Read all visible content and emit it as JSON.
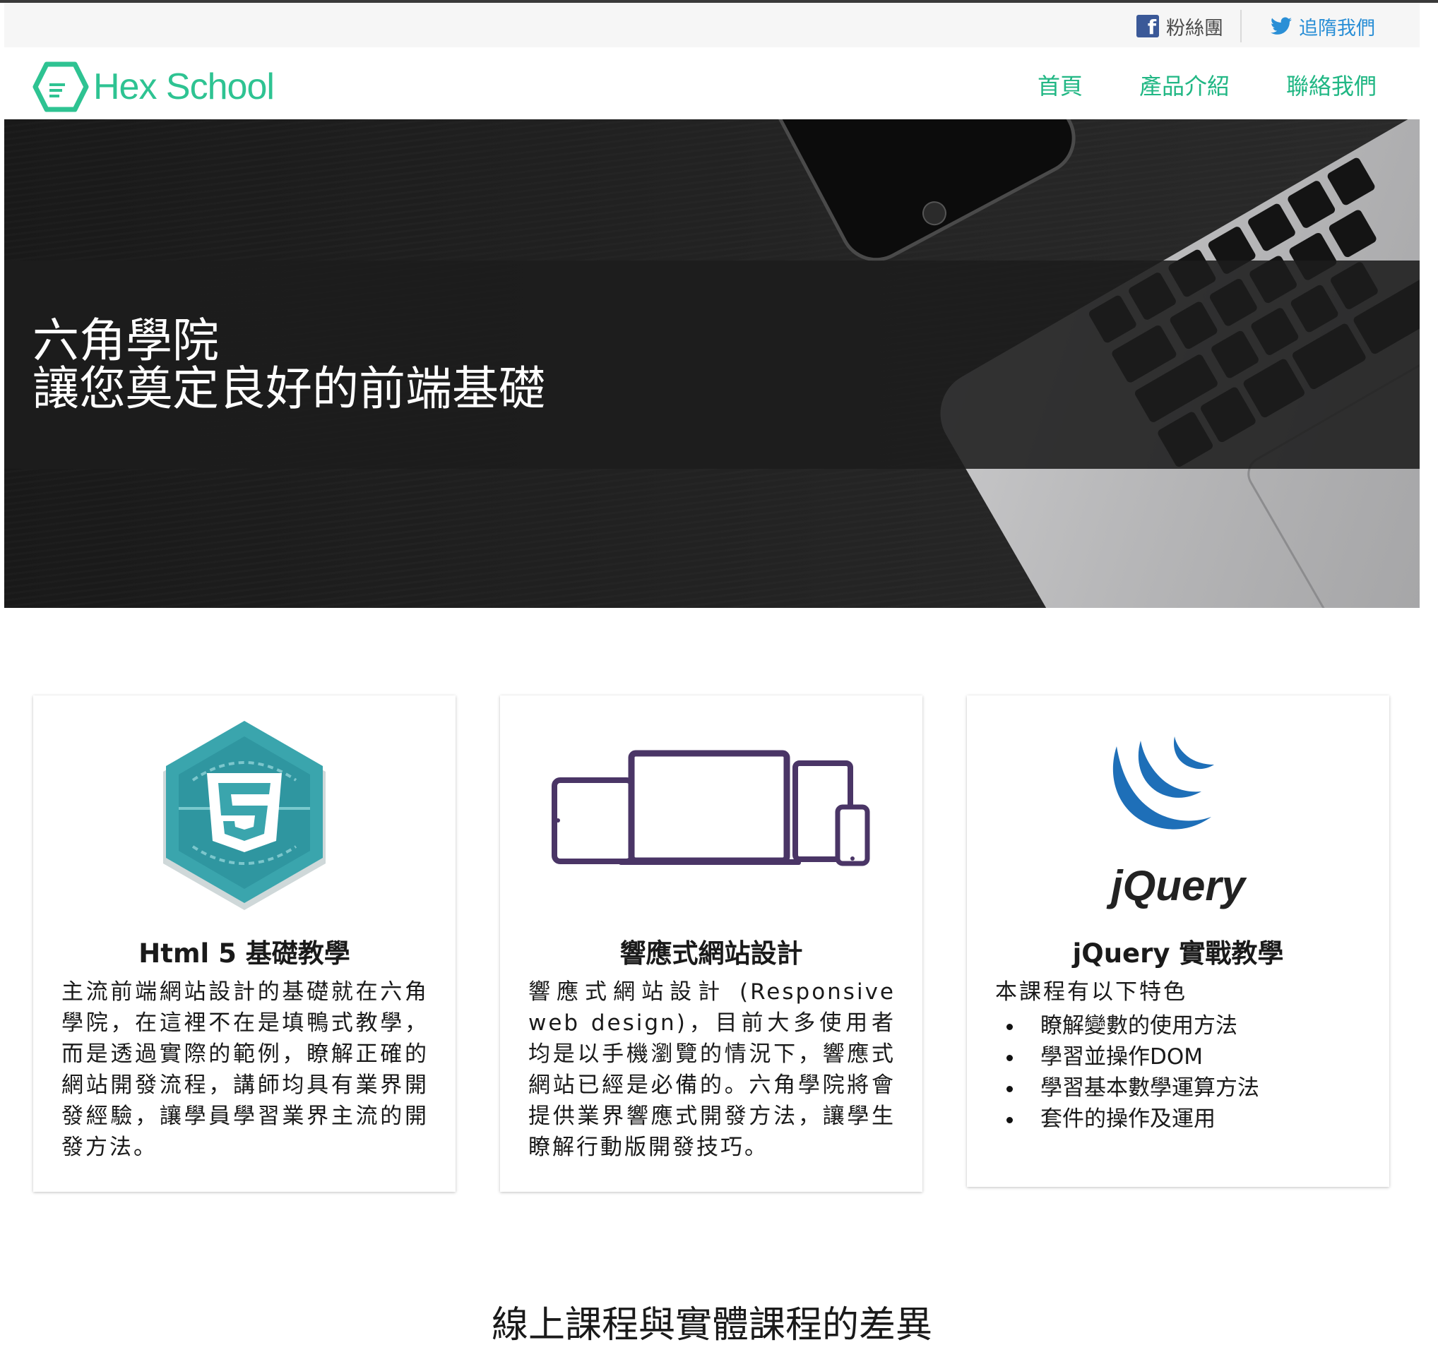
{
  "social": {
    "facebook_label": "粉絲團",
    "twitter_label": "追隋我們"
  },
  "nav": {
    "logo_text": "Hex School",
    "links": [
      "首頁",
      "產品介紹",
      "聯絡我們"
    ]
  },
  "hero": {
    "title_line1": "六角學院",
    "title_line2": "讓您奠定良好的前端基礎"
  },
  "cards": [
    {
      "icon": "html5-badge-icon",
      "title": "Html 5 基礎教學",
      "body": "主流前端網站設計的基礎就在六角學院，在這裡不在是填鴨式教學，而是透過實際的範例，瞭解正確的網站開發流程，講師均具有業界開發經驗，讓學員學習業界主流的開發方法。"
    },
    {
      "icon": "responsive-devices-icon",
      "title": "響應式網站設計",
      "body": "響應式網站設計 (Responsive web design)，目前大多使用者均是以手機瀏覽的情況下，響應式網站已經是必備的。六角學院將會提供業界響應式開發方法，讓學生瞭解行動版開發技巧。"
    },
    {
      "icon": "jquery-logo-icon",
      "logo_text": "jQuery",
      "title": "jQuery 實戰教學",
      "intro": "本課程有以下特色",
      "items": [
        "瞭解變數的使用方法",
        "學習並操作DOM",
        "學習基本數學運算方法",
        "套件的操作及運用"
      ]
    }
  ],
  "section": {
    "heading": "線上課程與實體課程的差異"
  },
  "colors": {
    "brand_green": "#21b784",
    "twitter_blue": "#2a8fd6",
    "facebook_blue": "#3b5998",
    "html5_teal": "#3aa5ad",
    "device_purple": "#4a3566",
    "jquery_blue": "#1e6fb8"
  }
}
